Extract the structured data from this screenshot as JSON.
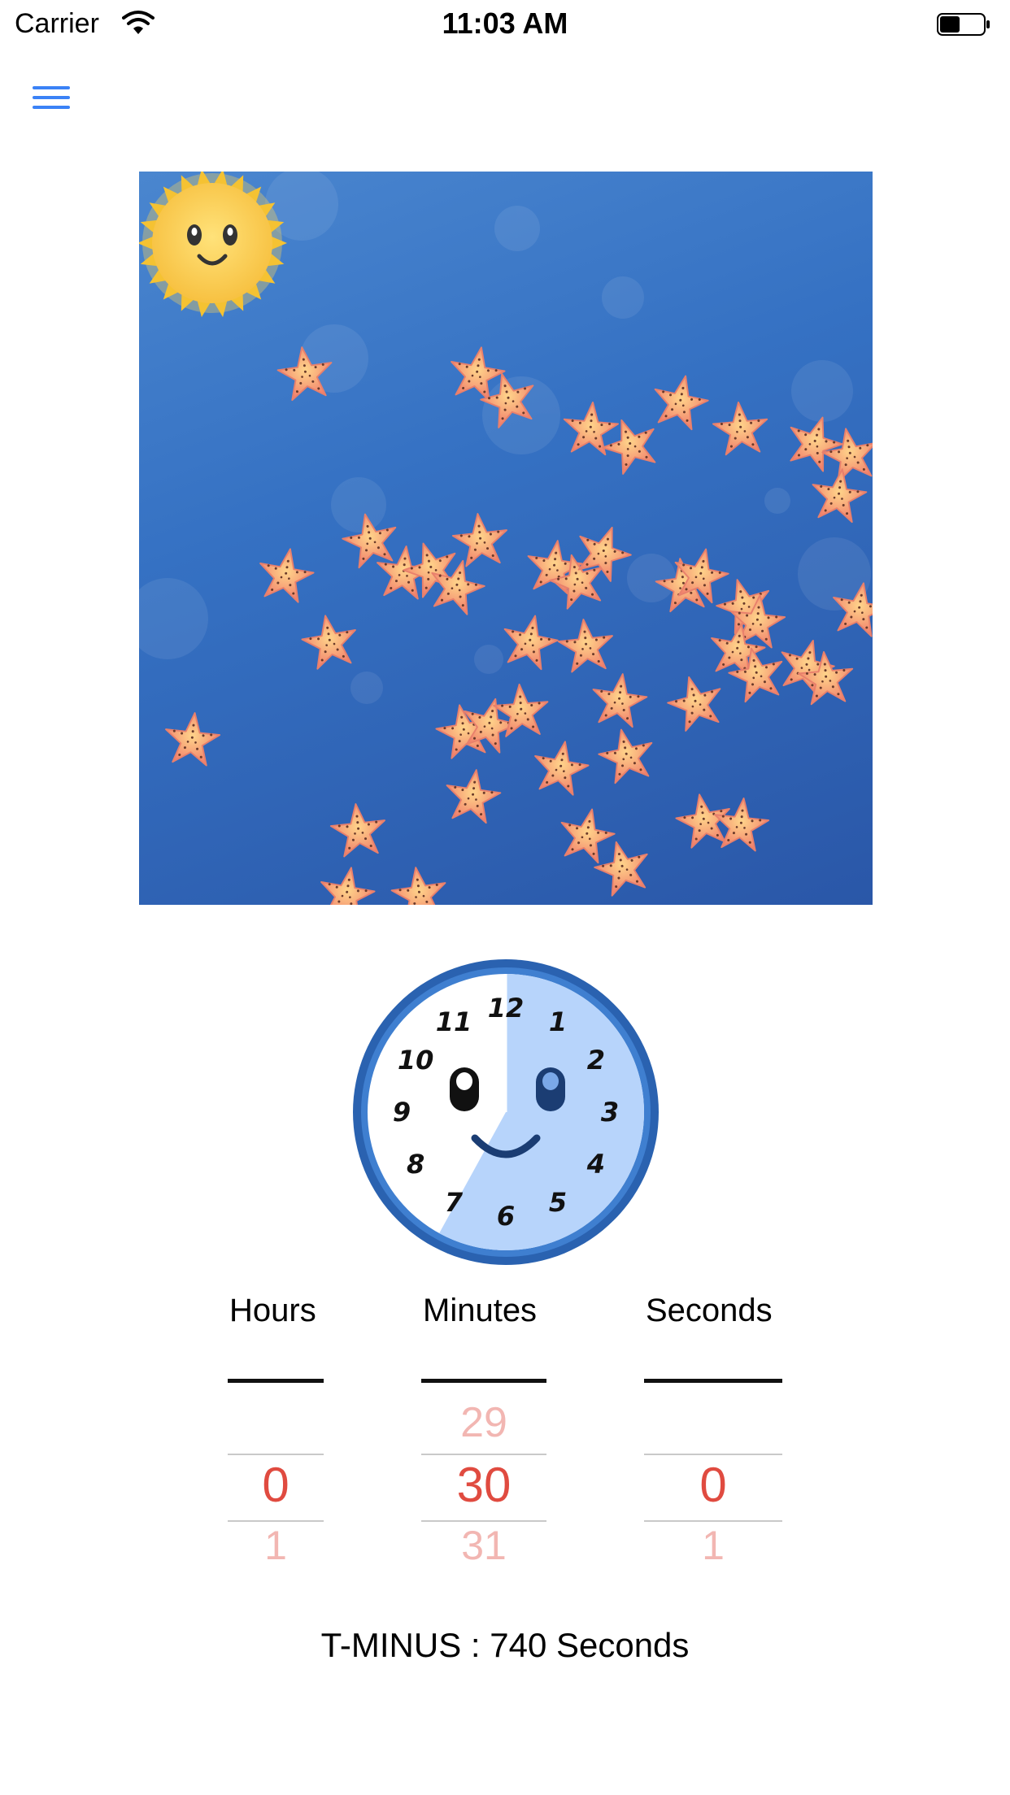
{
  "status_bar": {
    "carrier": "Carrier",
    "time": "11:03 AM",
    "wifi_icon": "wifi-icon",
    "battery_icon": "battery-icon"
  },
  "nav": {
    "menu_icon": "hamburger-menu-icon",
    "menu_color": "#3b82f6"
  },
  "scene": {
    "background_color": "#3571c3",
    "sun_icon": "smiling-sun-icon",
    "starfish_icon": "starfish-icon"
  },
  "clock": {
    "face_icon": "smiling-clock-face-icon",
    "numbers": [
      "12",
      "1",
      "2",
      "3",
      "4",
      "5",
      "6",
      "7",
      "8",
      "9",
      "10",
      "11"
    ],
    "elapsed_fraction": 0.58,
    "shade_color": "#b7d4fb",
    "rim_color": "#2a62b0"
  },
  "picker": {
    "columns": [
      {
        "label": "Hours",
        "above": "",
        "selected": "0",
        "below": "1"
      },
      {
        "label": "Minutes",
        "above": "29",
        "selected": "30",
        "below": "31"
      },
      {
        "label": "Seconds",
        "above": "",
        "selected": "0",
        "below": "1"
      }
    ]
  },
  "countdown": {
    "text": "T-MINUS : 740 Seconds"
  }
}
